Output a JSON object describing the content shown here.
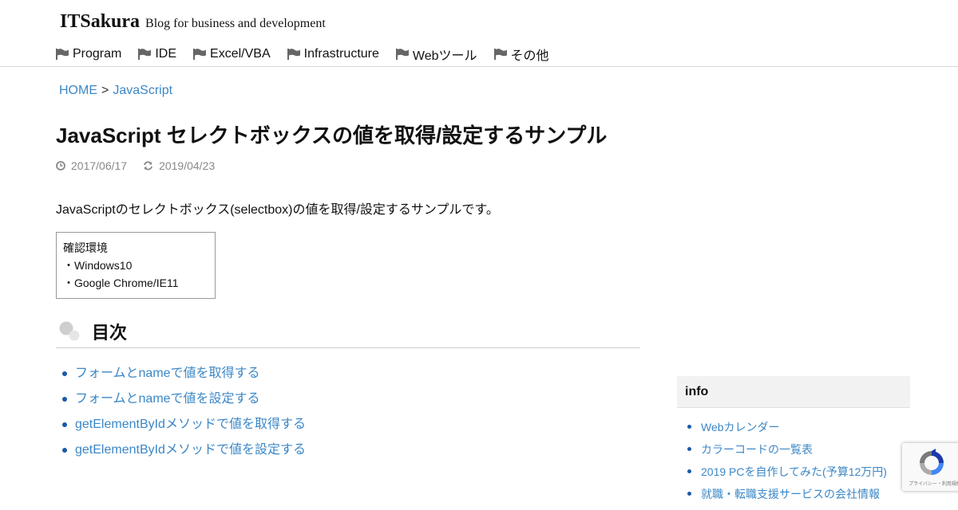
{
  "site": {
    "name": "ITSakura",
    "tagline": "Blog for business and development"
  },
  "nav": {
    "items": [
      {
        "label": "Program"
      },
      {
        "label": "IDE"
      },
      {
        "label": "Excel/VBA"
      },
      {
        "label": "Infrastructure"
      },
      {
        "label": "Webツール"
      },
      {
        "label": "その他"
      }
    ]
  },
  "breadcrumb": {
    "home": "HOME",
    "separator": ">",
    "category": "JavaScript"
  },
  "article": {
    "title": "JavaScript セレクトボックスの値を取得/設定するサンプル",
    "published": "2017/06/17",
    "updated": "2019/04/23",
    "intro": "JavaScriptのセレクトボックス(selectbox)の値を取得/設定するサンプルです。",
    "env_box": {
      "heading": "確認環境",
      "lines": [
        "・Windows10",
        "・Google Chrome/IE11"
      ]
    }
  },
  "toc": {
    "heading": "目次",
    "items": [
      "フォームとnameで値を取得する",
      "フォームとnameで値を設定する",
      "getElementByIdメソッドで値を取得する",
      "getElementByIdメソッドで値を設定する"
    ]
  },
  "sidebar": {
    "widget_title": "info",
    "links": [
      "Webカレンダー",
      "カラーコードの一覧表",
      "2019 PCを自作してみた(予算12万円)",
      "就職・転職支援サービスの会社情報"
    ]
  },
  "recaptcha": {
    "legal": "プライバシー・利用規約"
  },
  "colors": {
    "link": "#3c87c6",
    "bullet": "#1a5aa8",
    "meta": "#888888"
  }
}
